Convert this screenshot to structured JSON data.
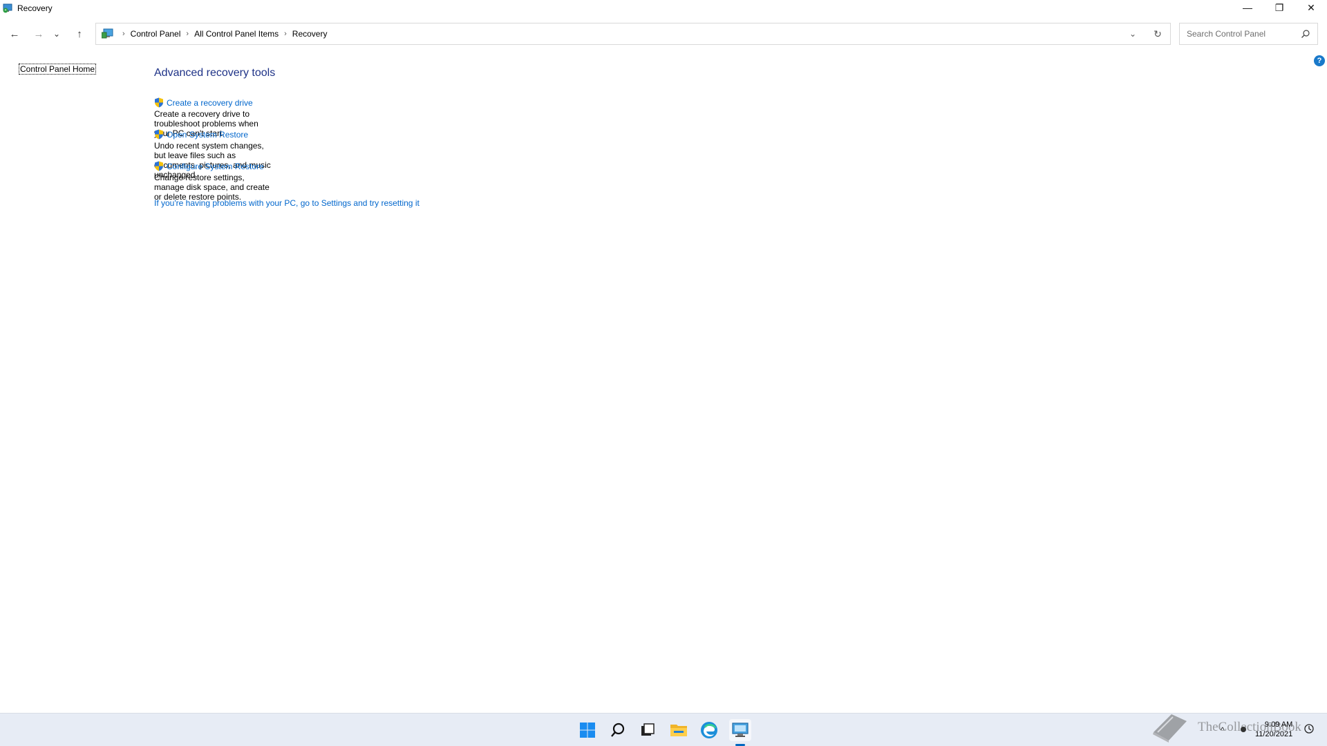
{
  "window": {
    "title": "Recovery",
    "minimize_glyph": "—",
    "restore_glyph": "❐",
    "close_glyph": "✕"
  },
  "nav": {
    "back_glyph": "←",
    "forward_glyph": "→",
    "recent_glyph": "⌄",
    "up_glyph": "↑",
    "breadcrumb": [
      "Control Panel",
      "All Control Panel Items",
      "Recovery"
    ],
    "breadcrumb_sep": "›",
    "dropdown_glyph": "⌄",
    "refresh_glyph": "↻"
  },
  "search": {
    "placeholder": "Search Control Panel"
  },
  "sidebar": {
    "home_label": "Control Panel Home"
  },
  "help": {
    "glyph": "?"
  },
  "main": {
    "heading": "Advanced recovery tools",
    "tasks": [
      {
        "label": "Create a recovery drive",
        "description": "Create a recovery drive to troubleshoot problems when your PC can't start."
      },
      {
        "label": "Open System Restore",
        "description": "Undo recent system changes, but leave files such as documents, pictures, and music unchanged."
      },
      {
        "label": "Configure System Restore",
        "description": "Change restore settings, manage disk space, and create or delete restore points."
      }
    ],
    "reset_link": "If you're having problems with your PC, go to Settings and try resetting it"
  },
  "taskbar": {
    "icons": [
      "start-icon",
      "search-icon",
      "task-view-icon",
      "file-explorer-icon",
      "edge-icon",
      "control-panel-icon"
    ],
    "watermark": "TheCollectionBook",
    "tray_chevron": "^",
    "time": "9:09 AM",
    "date": "11/20/2021"
  },
  "colors": {
    "link": "#0066cc",
    "heading": "#1e3287",
    "accent": "#0067c0",
    "taskbar_bg": "#e7ecf5"
  }
}
